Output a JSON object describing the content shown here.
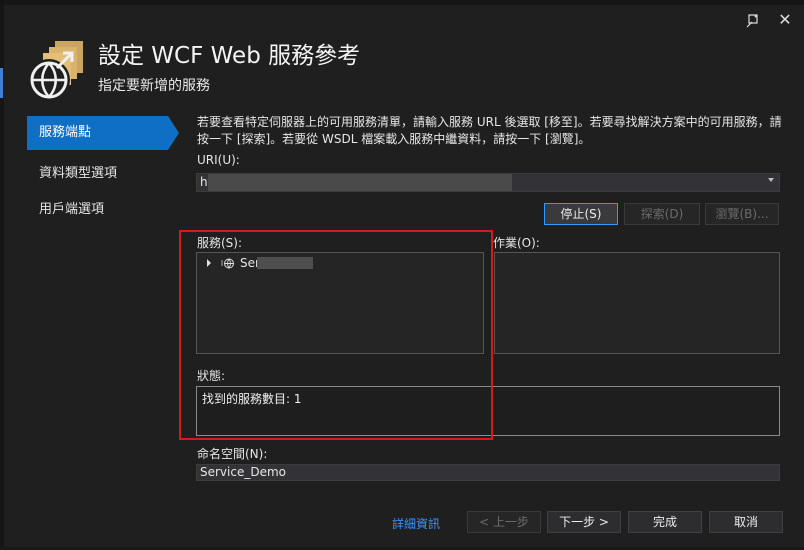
{
  "dialog": {
    "title": "設定 WCF Web 服務參考",
    "subtitle": "指定要新增的服務"
  },
  "nav": {
    "items": [
      {
        "label": "服務端點",
        "active": true
      },
      {
        "label": "資料類型選項",
        "active": false
      },
      {
        "label": "用戶端選項",
        "active": false
      }
    ]
  },
  "main": {
    "instructions": "若要查看特定伺服器上的可用服務清單，請輸入服務 URL 後選取 [移至]。若要尋找解決方案中的可用服務，請按一下 [探索]。若要從 WSDL 檔案載入服務中繼資料，請按一下 [瀏覽]。",
    "uri_label": "URI(U):",
    "uri_value": "ht",
    "buttons": {
      "stop": "停止(S)",
      "discover": "探索(D)",
      "browse": "瀏覽(B)..."
    },
    "services_label": "服務(S):",
    "service_item": "Serv",
    "operations_label": "作業(O):",
    "status_label": "狀態:",
    "status_text": "找到的服務數目: 1",
    "namespace_label": "命名空間(N):",
    "namespace_value": "Service_Demo"
  },
  "footer": {
    "details": "詳細資訊",
    "prev": "< 上一步",
    "next": "下一步 >",
    "finish": "完成",
    "cancel": "取消"
  },
  "colors": {
    "accent": "#0e6fc5",
    "background": "#1f1f1f",
    "link": "#3794ff",
    "highlight_box": "#d61a1a"
  },
  "icons": [
    "wcf-globe-icon",
    "pin-icon",
    "close-icon",
    "expand-arrow-icon",
    "service-icon",
    "dropdown-caret-icon"
  ]
}
